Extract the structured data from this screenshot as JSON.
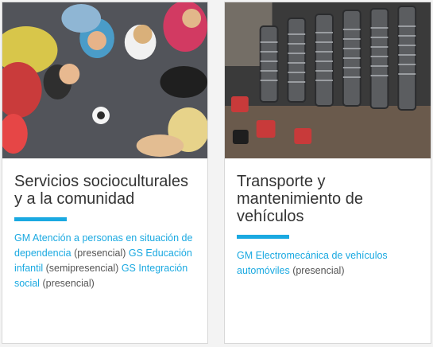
{
  "cards": [
    {
      "image_alt": "children playing on the floor",
      "title": "Servicios socioculturales y a la comunidad",
      "accent": "#1aa9e1",
      "courses": [
        {
          "link": "GM Atención a personas en situación de dependencia",
          "modality": "(presencial)"
        },
        {
          "link": "GS Educación infantil",
          "modality": "(semipresencial)"
        },
        {
          "link": "GS Integración social",
          "modality": "(presencial)"
        }
      ]
    },
    {
      "image_alt": "engine valve springs close-up",
      "title": "Transporte y mantenimiento de vehículos",
      "accent": "#1aa9e1",
      "courses": [
        {
          "link": "GM Electromecánica de vehículos automóviles",
          "modality": "(presencial)"
        }
      ]
    }
  ]
}
